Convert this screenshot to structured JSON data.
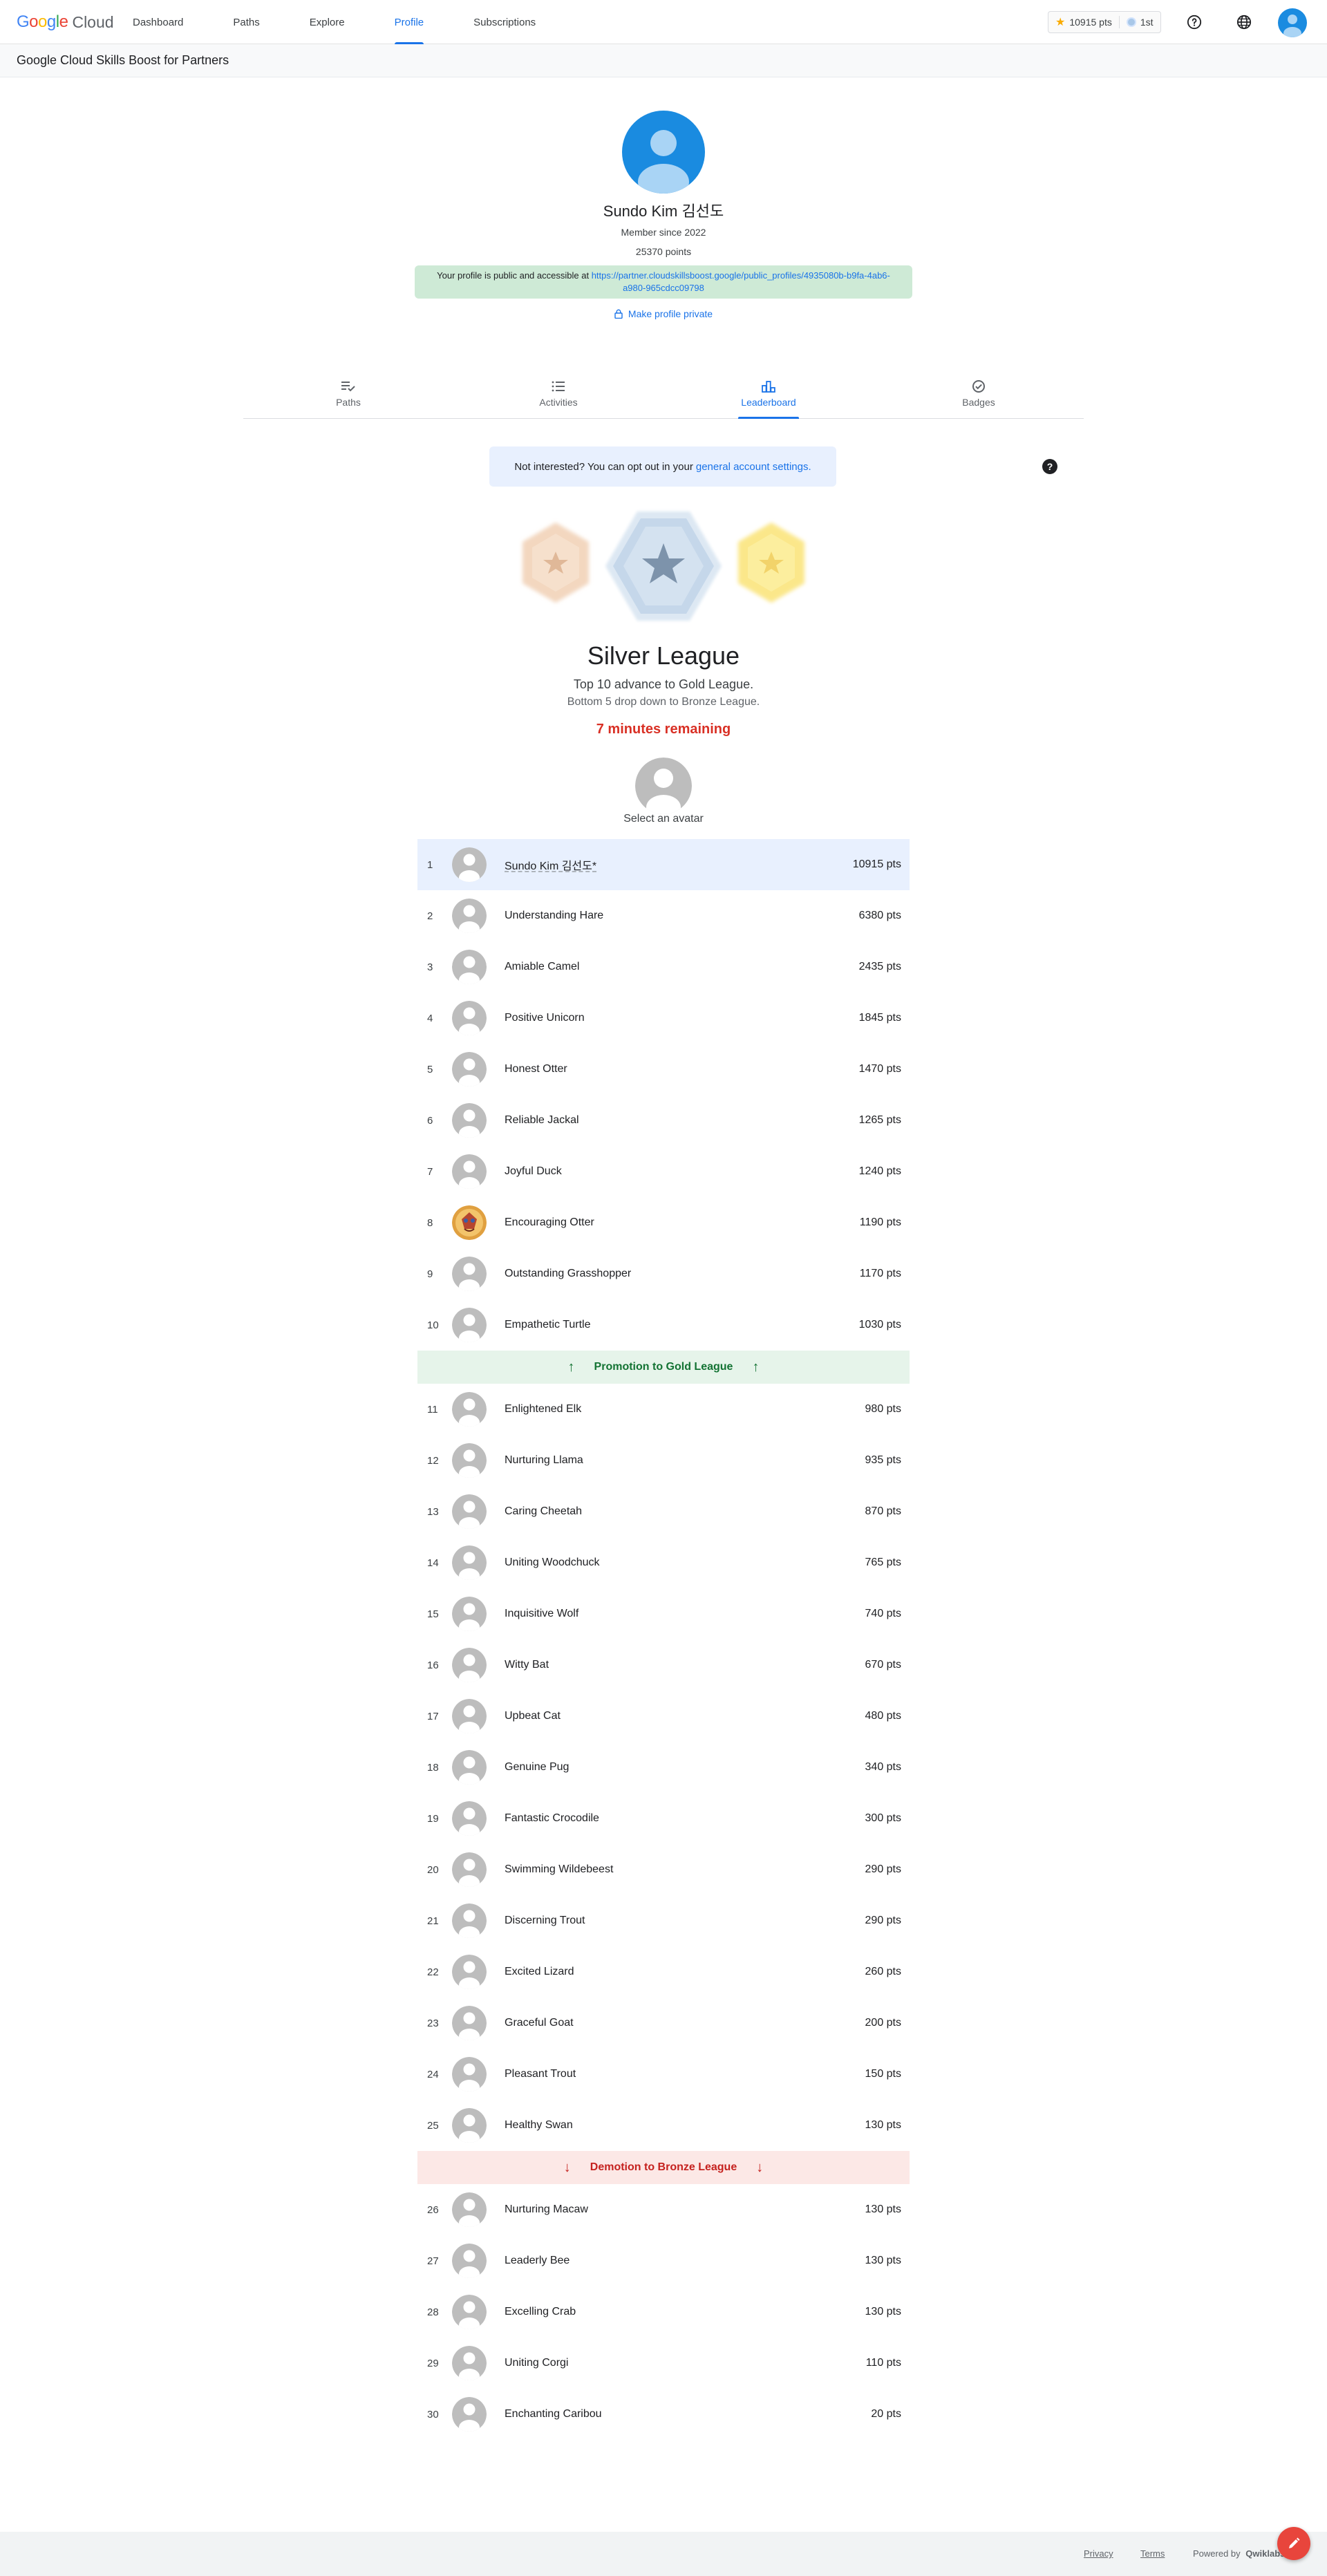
{
  "header": {
    "logo_google": "Google",
    "logo_cloud": "Cloud",
    "nav": [
      {
        "label": "Dashboard"
      },
      {
        "label": "Paths"
      },
      {
        "label": "Explore"
      },
      {
        "label": "Profile",
        "active": true
      },
      {
        "label": "Subscriptions"
      }
    ],
    "points_chip": "10915 pts",
    "rank_chip": "1st",
    "colors": {
      "accent": "#1a73e8",
      "star": "#f9ab00"
    }
  },
  "subheader": {
    "title": "Google Cloud Skills Boost for Partners"
  },
  "profile": {
    "name": "Sundo Kim 김선도",
    "member_since": "Member since 2022",
    "points": "25370 points",
    "public_text": "Your profile is public and accessible at",
    "public_url": "https://partner.cloudskillsboost.google/public_profiles/4935080b-b9fa-4ab6-a980-965cdcc09798",
    "make_private": "Make profile private"
  },
  "tabs": [
    {
      "label": "Paths",
      "icon": "paths-icon"
    },
    {
      "label": "Activities",
      "icon": "list-icon"
    },
    {
      "label": "Leaderboard",
      "icon": "leaderboard-icon",
      "active": true
    },
    {
      "label": "Badges",
      "icon": "badge-check-icon"
    }
  ],
  "league": {
    "optout_text": "Not interested? You can opt out in your",
    "optout_link": "general account settings.",
    "title": "Silver League",
    "advance": "Top 10 advance to Gold League.",
    "drop": "Bottom 5 drop down to Bronze League.",
    "remaining": "7 minutes remaining",
    "select_avatar": "Select an avatar",
    "promotion": "Promotion to Gold League",
    "demotion": "Demotion to Bronze League",
    "colors": {
      "bronze": "#f3d7bf",
      "silver": "#c9d9ea",
      "gold": "#fbe78a",
      "remaining": "#d93025"
    }
  },
  "leaderboard": [
    {
      "rank": "1",
      "name": "Sundo Kim 김선도*",
      "pts": "10915 pts",
      "me": true
    },
    {
      "rank": "2",
      "name": "Understanding Hare",
      "pts": "6380 pts"
    },
    {
      "rank": "3",
      "name": "Amiable Camel",
      "pts": "2435 pts"
    },
    {
      "rank": "4",
      "name": "Positive Unicorn",
      "pts": "1845 pts"
    },
    {
      "rank": "5",
      "name": "Honest Otter",
      "pts": "1470 pts"
    },
    {
      "rank": "6",
      "name": "Reliable Jackal",
      "pts": "1265 pts"
    },
    {
      "rank": "7",
      "name": "Joyful Duck",
      "pts": "1240 pts"
    },
    {
      "rank": "8",
      "name": "Encouraging Otter",
      "pts": "1190 pts",
      "custom_avatar": true
    },
    {
      "rank": "9",
      "name": "Outstanding Grasshopper",
      "pts": "1170 pts"
    },
    {
      "rank": "10",
      "name": "Empathetic Turtle",
      "pts": "1030 pts"
    },
    {
      "rank": "11",
      "name": "Enlightened Elk",
      "pts": "980 pts"
    },
    {
      "rank": "12",
      "name": "Nurturing Llama",
      "pts": "935 pts"
    },
    {
      "rank": "13",
      "name": "Caring Cheetah",
      "pts": "870 pts"
    },
    {
      "rank": "14",
      "name": "Uniting Woodchuck",
      "pts": "765 pts"
    },
    {
      "rank": "15",
      "name": "Inquisitive Wolf",
      "pts": "740 pts"
    },
    {
      "rank": "16",
      "name": "Witty Bat",
      "pts": "670 pts"
    },
    {
      "rank": "17",
      "name": "Upbeat Cat",
      "pts": "480 pts"
    },
    {
      "rank": "18",
      "name": "Genuine Pug",
      "pts": "340 pts"
    },
    {
      "rank": "19",
      "name": "Fantastic Crocodile",
      "pts": "300 pts"
    },
    {
      "rank": "20",
      "name": "Swimming Wildebeest",
      "pts": "290 pts"
    },
    {
      "rank": "21",
      "name": "Discerning Trout",
      "pts": "290 pts"
    },
    {
      "rank": "22",
      "name": "Excited Lizard",
      "pts": "260 pts"
    },
    {
      "rank": "23",
      "name": "Graceful Goat",
      "pts": "200 pts"
    },
    {
      "rank": "24",
      "name": "Pleasant Trout",
      "pts": "150 pts"
    },
    {
      "rank": "25",
      "name": "Healthy Swan",
      "pts": "130 pts"
    },
    {
      "rank": "26",
      "name": "Nurturing Macaw",
      "pts": "130 pts"
    },
    {
      "rank": "27",
      "name": "Leaderly Bee",
      "pts": "130 pts"
    },
    {
      "rank": "28",
      "name": "Excelling Crab",
      "pts": "130 pts"
    },
    {
      "rank": "29",
      "name": "Uniting Corgi",
      "pts": "110 pts"
    },
    {
      "rank": "30",
      "name": "Enchanting Caribou",
      "pts": "20 pts"
    }
  ],
  "footer": {
    "privacy": "Privacy",
    "terms": "Terms",
    "powered_by": "Powered by",
    "powered_brand": "Qwiklabs"
  }
}
